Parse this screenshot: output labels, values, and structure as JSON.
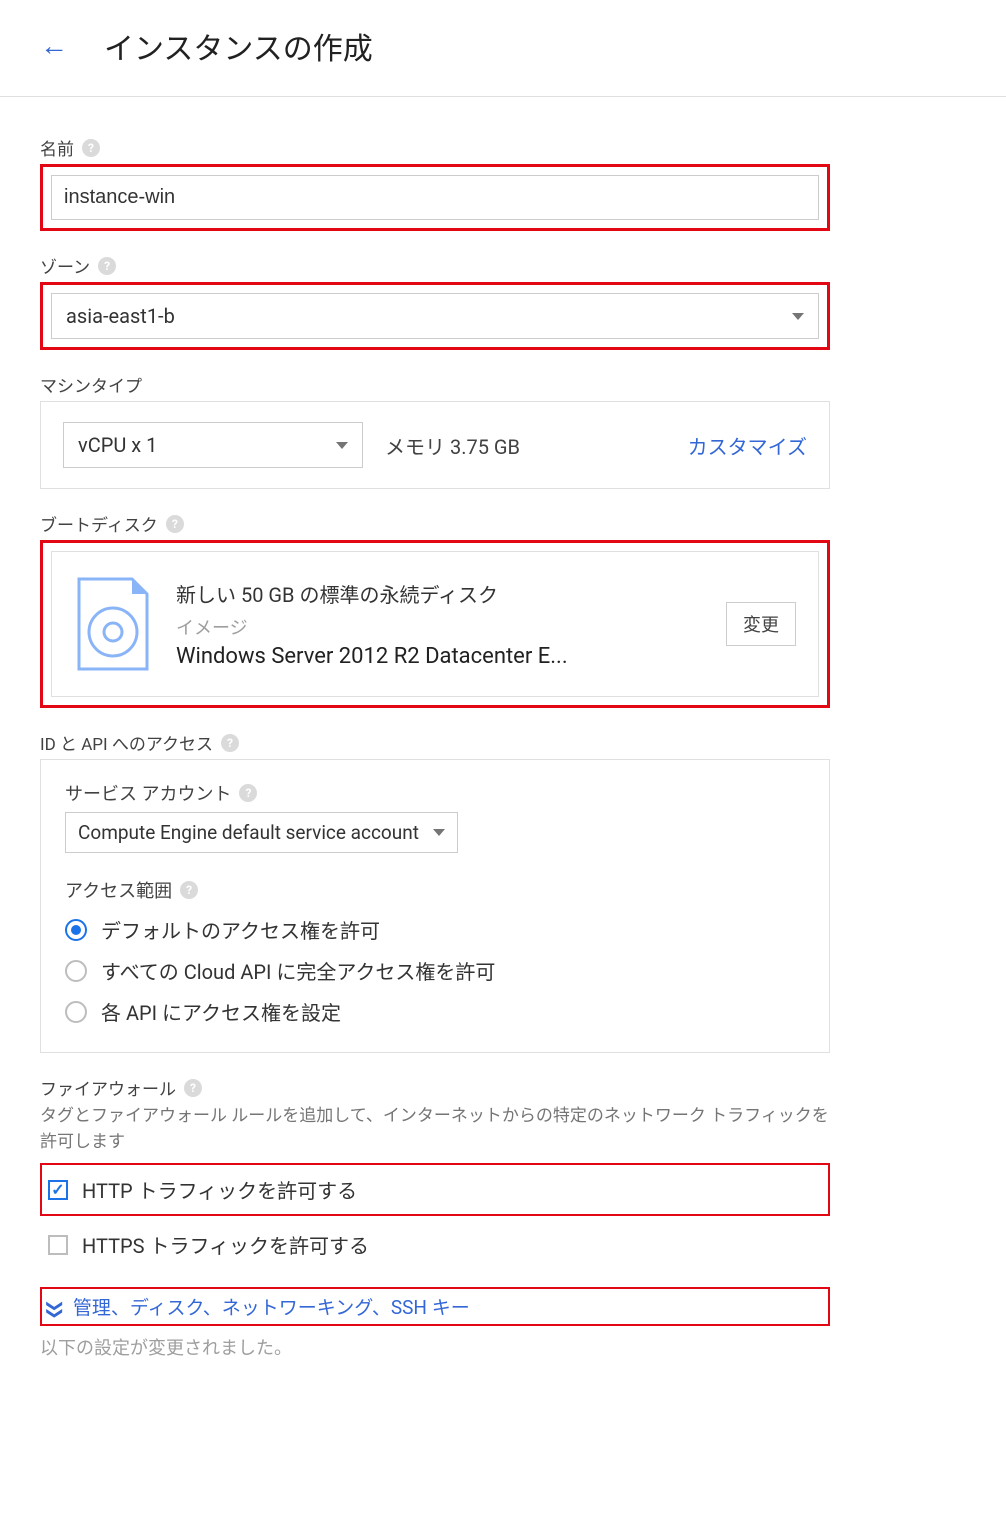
{
  "header": {
    "title": "インスタンスの作成"
  },
  "name": {
    "label": "名前",
    "value": "instance-win"
  },
  "zone": {
    "label": "ゾーン",
    "value": "asia-east1-b"
  },
  "machine": {
    "label": "マシンタイプ",
    "cpu": "vCPU x 1",
    "memory": "メモリ 3.75 GB",
    "customize": "カスタマイズ"
  },
  "boot": {
    "label": "ブートディスク",
    "disk_desc": "新しい 50 GB の標準の永続ディスク",
    "image_label": "イメージ",
    "image_value": "Windows Server 2012 R2 Datacenter E...",
    "change": "変更"
  },
  "api": {
    "label": "ID と API へのアクセス",
    "service_label": "サービス アカウント",
    "service_value": "Compute Engine default service account",
    "scope_label": "アクセス範囲",
    "scopes": [
      "デフォルトのアクセス権を許可",
      "すべての Cloud API に完全アクセス権を許可",
      "各 API にアクセス権を設定"
    ]
  },
  "firewall": {
    "label": "ファイアウォール",
    "desc": "タグとファイアウォール ルールを追加して、インターネットからの特定のネットワーク トラフィックを許可します",
    "http": "HTTP トラフィックを許可する",
    "https": "HTTPS トラフィックを許可する"
  },
  "expand": {
    "label": "管理、ディスク、ネットワーキング、SSH キー"
  },
  "changed_note": "以下の設定が変更されました。"
}
